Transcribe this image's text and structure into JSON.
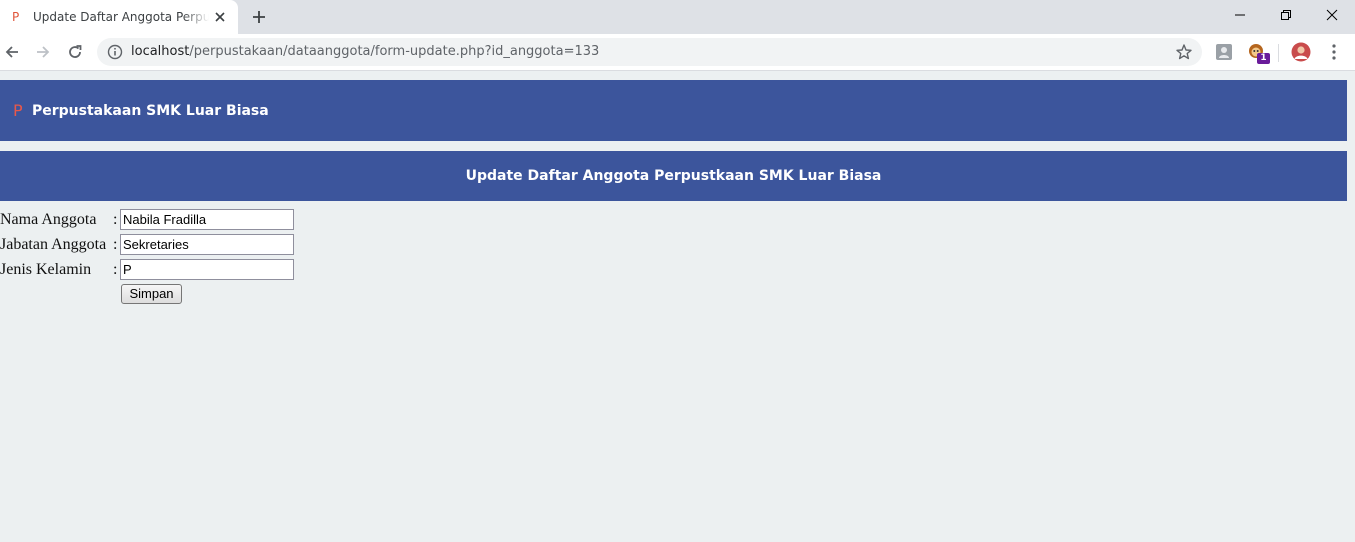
{
  "browser": {
    "tab": {
      "title": "Update Daftar Anggota Perpustakaan SMK Luar Biasa",
      "favicon": "P"
    },
    "address": {
      "host": "localhost",
      "path": "/perpustakaan/dataanggota/form-update.php?id_anggota=133"
    },
    "extensions": {
      "badge_count": "1"
    },
    "icons": [
      "back-icon",
      "forward-icon",
      "reload-icon",
      "info-icon",
      "star-icon",
      "close-icon",
      "plus-icon",
      "minimize-icon",
      "maximize-icon",
      "menu-icon"
    ]
  },
  "header": {
    "brand_mark": "P",
    "brand_name": "Perpustakaan SMK Luar Biasa"
  },
  "main": {
    "title": "Update Daftar Anggota Perpustkaan SMK Luar Biasa"
  },
  "form": {
    "fields": [
      {
        "label": "Nama Anggota",
        "value": "Nabila Fradilla"
      },
      {
        "label": "Jabatan Anggota",
        "value": "Sekretaries"
      },
      {
        "label": "Jenis Kelamin",
        "value": "P"
      }
    ],
    "separator": ":",
    "submit_label": "Simpan"
  },
  "colors": {
    "header_bg": "#3c559c",
    "page_bg": "#ecf0f1",
    "brand_mark": "#e8584a"
  }
}
